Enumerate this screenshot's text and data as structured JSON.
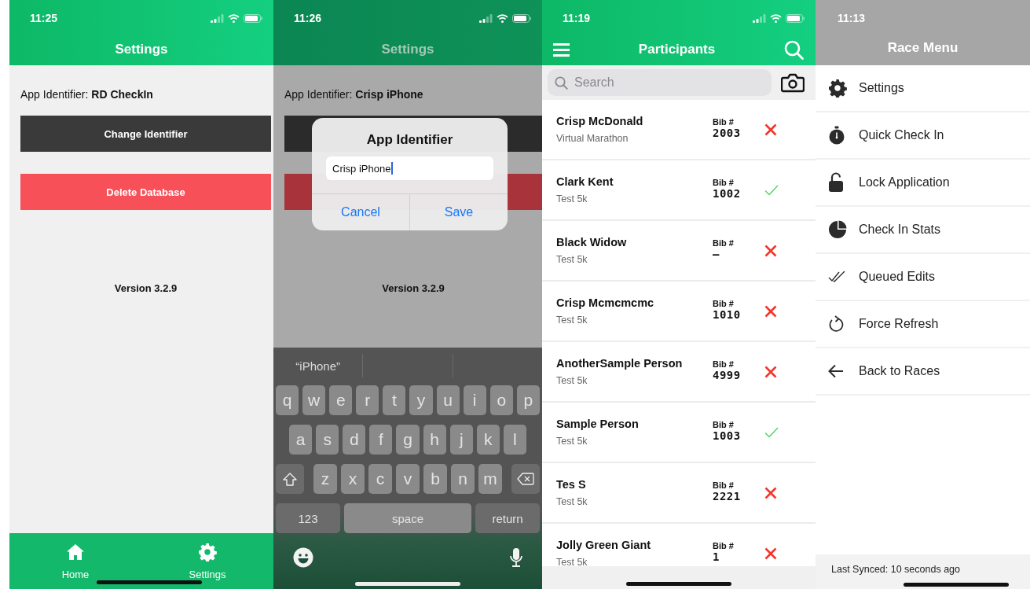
{
  "settings_screen": {
    "status_time": "11:25",
    "title": "Settings",
    "identifier_label": "App Identifier: **RD CheckIn**",
    "buttons": [
      {
        "label": "Change Identifier",
        "kind": "neutral"
      },
      {
        "label": "Delete Database",
        "kind": "danger"
      }
    ],
    "version": "Version 3.2.9",
    "tab_bar": [
      {
        "label": "Home"
      },
      {
        "label": "Settings"
      }
    ]
  },
  "identifier_dialog_screen": {
    "status_time": "11:26",
    "title": "Settings",
    "identifier_label": "App Identifier: **Crisp iPhone**",
    "buttons": [
      {
        "kind": "neutral"
      },
      {
        "kind": "danger"
      }
    ],
    "version": "Version 3.2.9",
    "dialog": {
      "title": "App Identifier",
      "value": "Crisp iPhone",
      "actions": [
        "Cancel",
        "Save"
      ]
    },
    "keyboard": {
      "suggestion": "“iPhone”",
      "rows": [
        [
          "q",
          "w",
          "e",
          "r",
          "t",
          "y",
          "u",
          "i",
          "o",
          "p"
        ],
        [
          "a",
          "s",
          "d",
          "f",
          "g",
          "h",
          "j",
          "k",
          "l"
        ],
        [
          "z",
          "x",
          "c",
          "v",
          "b",
          "n",
          "m"
        ]
      ],
      "bottom_keys": [
        "123",
        "space",
        "return"
      ]
    }
  },
  "participants_screen": {
    "status_time": "11:19",
    "title": "Participants",
    "search": {
      "placeholder": "Search"
    },
    "participants": [
      {
        "name": "Crisp McDonald",
        "event": "Virtual Marathon",
        "bib_label": "Bib #",
        "bib": "2003",
        "checked_in": false
      },
      {
        "name": "Clark Kent",
        "event": "Test 5k",
        "bib_label": "Bib #",
        "bib": "1002",
        "checked_in": true
      },
      {
        "name": "Black Widow",
        "event": "Test 5k",
        "bib_label": "Bib #",
        "bib": "—",
        "checked_in": false
      },
      {
        "name": "Crisp Mcmcmcmc",
        "event": "Test 5k",
        "bib_label": "Bib #",
        "bib": "1010",
        "checked_in": false
      },
      {
        "name": "AnotherSample Person",
        "event": "Test 5k",
        "bib_label": "Bib #",
        "bib": "4999",
        "checked_in": false
      },
      {
        "name": "Sample Person",
        "event": "Test 5k",
        "bib_label": "Bib #",
        "bib": "1003",
        "checked_in": true
      },
      {
        "name": "Tes S",
        "event": "Test 5k",
        "bib_label": "Bib #",
        "bib": "2221",
        "checked_in": false
      },
      {
        "name": "Jolly Green Giant",
        "event": "Test 5k",
        "bib_label": "Bib #",
        "bib": "1",
        "checked_in": false
      }
    ]
  },
  "race_menu_screen": {
    "status_time": "11:13",
    "title": "Race Menu",
    "menu_items": [
      {
        "label": "Settings"
      },
      {
        "label": "Quick Check In"
      },
      {
        "label": "Lock Application"
      },
      {
        "label": "Check In Stats"
      },
      {
        "label": "Queued Edits"
      },
      {
        "label": "Force Refresh"
      },
      {
        "label": "Back to Races"
      }
    ],
    "last_synced": "Last Synced: 10 seconds ago"
  }
}
